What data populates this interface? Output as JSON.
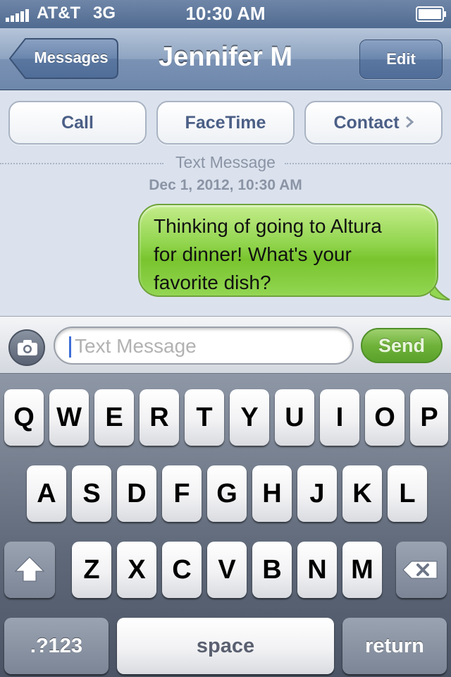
{
  "status_bar": {
    "carrier": "AT&T",
    "network": "3G",
    "time": "10:30 AM"
  },
  "nav": {
    "back_label": "Messages",
    "title": "Jennifer M",
    "edit_label": "Edit"
  },
  "actions": {
    "call": "Call",
    "facetime": "FaceTime",
    "contact": "Contact"
  },
  "conversation": {
    "type_label": "Text Message",
    "date": "Dec 1, 2012, 10:30 AM",
    "messages": [
      {
        "from": "me",
        "lines": [
          "Thinking of going to Altura",
          "for dinner! What's your",
          "favorite dish?"
        ]
      }
    ]
  },
  "input": {
    "placeholder": "Text Message",
    "value": "",
    "send_label": "Send"
  },
  "keyboard": {
    "row1": [
      "Q",
      "W",
      "E",
      "R",
      "T",
      "Y",
      "U",
      "I",
      "O",
      "P"
    ],
    "row2": [
      "A",
      "S",
      "D",
      "F",
      "G",
      "H",
      "J",
      "K",
      "L"
    ],
    "row3": [
      "Z",
      "X",
      "C",
      "V",
      "B",
      "N",
      "M"
    ],
    "mode_label": ".?123",
    "space_label": "space",
    "return_label": "return"
  },
  "colors": {
    "nav_blue": "#6d87ab",
    "bubble_green": "#8ed34a",
    "send_green": "#6fb23a",
    "background": "#dbe2ed"
  },
  "icons": [
    "signal-icon",
    "battery-icon",
    "chevron-right-icon",
    "camera-icon",
    "shift-icon",
    "delete-icon"
  ]
}
